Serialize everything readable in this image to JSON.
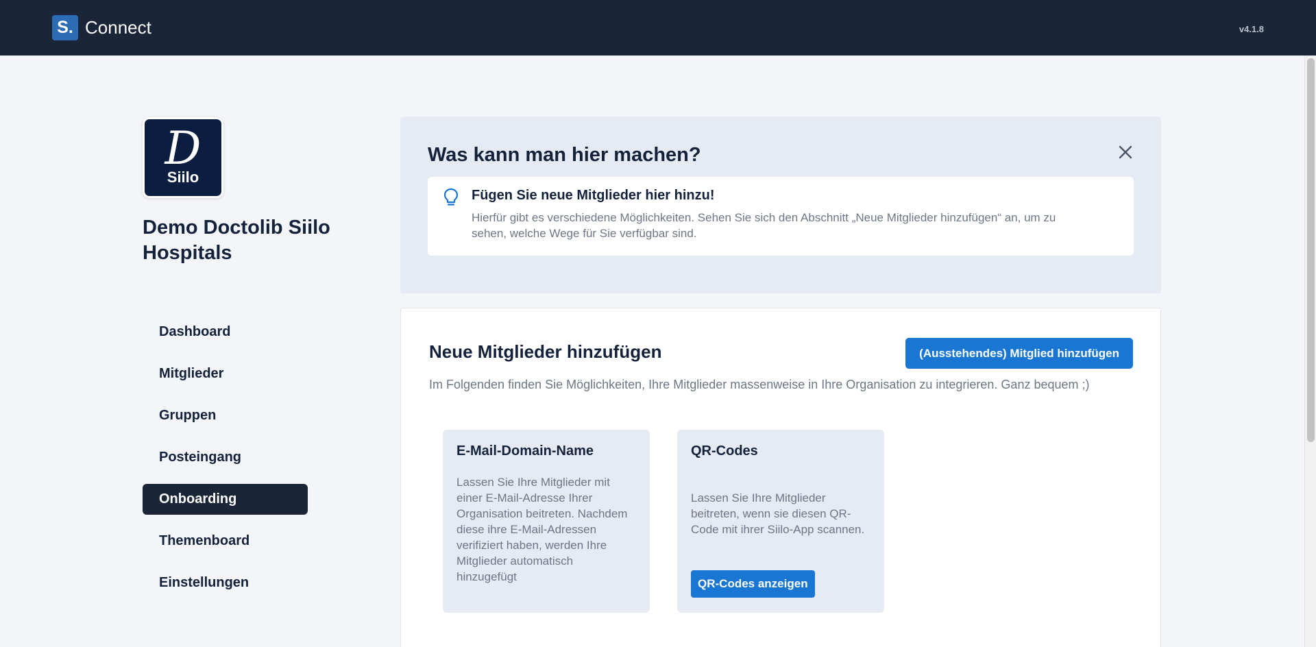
{
  "header": {
    "logo_text": "S.",
    "app_name": "Connect",
    "version": "v4.1.8"
  },
  "organization": {
    "logo_letter": "D",
    "logo_label": "Siilo",
    "name": "Demo Doctolib Siilo Hospitals"
  },
  "sidebar": {
    "items": [
      {
        "label": "Dashboard",
        "active": false
      },
      {
        "label": "Mitglieder",
        "active": false
      },
      {
        "label": "Gruppen",
        "active": false
      },
      {
        "label": "Posteingang",
        "active": false
      },
      {
        "label": "Onboarding",
        "active": true
      },
      {
        "label": "Themenboard",
        "active": false
      },
      {
        "label": "Einstellungen",
        "active": false
      }
    ]
  },
  "info_panel": {
    "title": "Was kann man hier machen?",
    "close_icon": "close-icon",
    "tip_icon": "lightbulb-icon",
    "tip_title": "Fügen Sie neue Mitglieder hier hinzu!",
    "tip_text": "Hierfür gibt es verschiedene Möglichkeiten. Sehen Sie sich den Abschnitt „Neue Mitglieder hinzufügen“ an, um zu sehen, welche Wege für Sie verfügbar sind."
  },
  "main": {
    "title": "Neue Mitglieder hinzufügen",
    "add_button": "(Ausstehendes) Mitglied hinzufügen",
    "subtitle": "Im Folgenden finden Sie Möglichkeiten, Ihre Mitglieder massenweise in Ihre Organisation zu integrieren. Ganz bequem ;)",
    "options": [
      {
        "title": "E-Mail-Domain-Name",
        "text": "Lassen Sie Ihre Mitglieder mit einer E-Mail-Adresse Ihrer Organisation beitreten. Nachdem diese ihre E-Mail-Adressen verifiziert haben, werden Ihre Mitglieder automatisch hinzugefügt"
      },
      {
        "title": "QR-Codes",
        "text": "Lassen Sie Ihre Mitglieder beitreten, wenn sie diesen QR-Code mit ihrer Siilo-App scannen.",
        "button": "QR-Codes anzeigen"
      }
    ]
  },
  "colors": {
    "topbar": "#1b2538",
    "accent": "#1976d2",
    "panel": "#e6eaf2"
  }
}
